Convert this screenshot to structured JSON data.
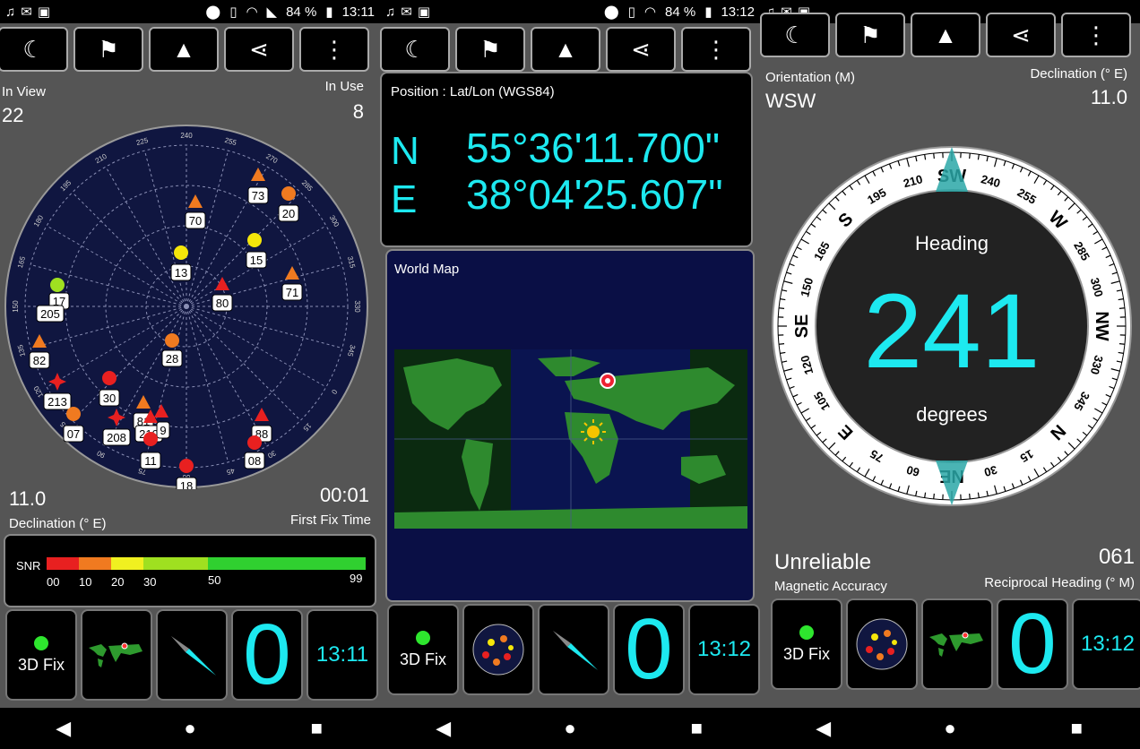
{
  "status_bar": {
    "left": {
      "time": "13:11",
      "battery": "84 %"
    },
    "middle": {
      "time": "13:12",
      "battery": "84 %"
    },
    "right": {}
  },
  "toolbar": {
    "items": [
      "moon-icon",
      "person-flag-icon",
      "navigation-arrow-icon",
      "share-icon",
      "more-vert-icon"
    ]
  },
  "sky_panel": {
    "in_view_label": "In View",
    "in_view_value": "22",
    "in_use_label": "In Use",
    "in_use_value": "8",
    "declination_value": "11.0",
    "declination_label": "Declination (° E)",
    "first_fix_value": "00:01",
    "first_fix_label": "First Fix Time",
    "azimuth_ticks": [
      "240",
      "255",
      "270",
      "285",
      "300",
      "315",
      "330",
      "345",
      "0",
      "15",
      "30",
      "45",
      "60",
      "75",
      "90",
      "105",
      "120",
      "135",
      "150",
      "165",
      "180",
      "195",
      "210",
      "225"
    ],
    "satellites": [
      "73",
      "20",
      "70",
      "15",
      "13",
      "71",
      "80",
      "17",
      "205",
      "28",
      "82",
      "30",
      "213",
      "81",
      "210",
      "9",
      "88",
      "07",
      "208",
      "11",
      "08",
      "18"
    ],
    "snr": {
      "label": "SNR",
      "ticks": [
        "00",
        "10",
        "20",
        "30",
        "50",
        "99"
      ],
      "colors": [
        "#e82020",
        "#f07a20",
        "#f0f020",
        "#9fe020",
        "#30d030"
      ]
    }
  },
  "position_panel": {
    "title": "Position : Lat/Lon (WGS84)",
    "lat_hemisphere": "N",
    "lat_value": "55°36'11.700\"",
    "lon_hemisphere": "E",
    "lon_value": "38°04'25.607\""
  },
  "map_panel": {
    "title": "World Map"
  },
  "compass_panel": {
    "orientation_label": "Orientation (M)",
    "orientation_value": "WSW",
    "declination_label": "Declination (° E)",
    "declination_value": "11.0",
    "heading_label": "Heading",
    "heading_value": "241",
    "heading_unit": "degrees",
    "accuracy_value": "Unreliable",
    "accuracy_label": "Magnetic Accuracy",
    "reciprocal_value": "061",
    "reciprocal_label": "Reciprocal Heading (° M)",
    "dial_labels": [
      "SW",
      "240",
      "255",
      "W",
      "285",
      "300",
      "NW",
      "330",
      "345",
      "N",
      "15",
      "30",
      "NE",
      "60",
      "75",
      "E",
      "105",
      "120",
      "SE",
      "150",
      "165",
      "S",
      "195",
      "210"
    ]
  },
  "bottom_tiles": {
    "fix_label": "3D Fix",
    "sats_count": "0",
    "time_left": "13:11",
    "time_mid": "13:12",
    "time_right": "13:12"
  },
  "colors": {
    "accent": "#1de9f0",
    "panel_bg": "#555555",
    "sky_bg": "#101640"
  }
}
